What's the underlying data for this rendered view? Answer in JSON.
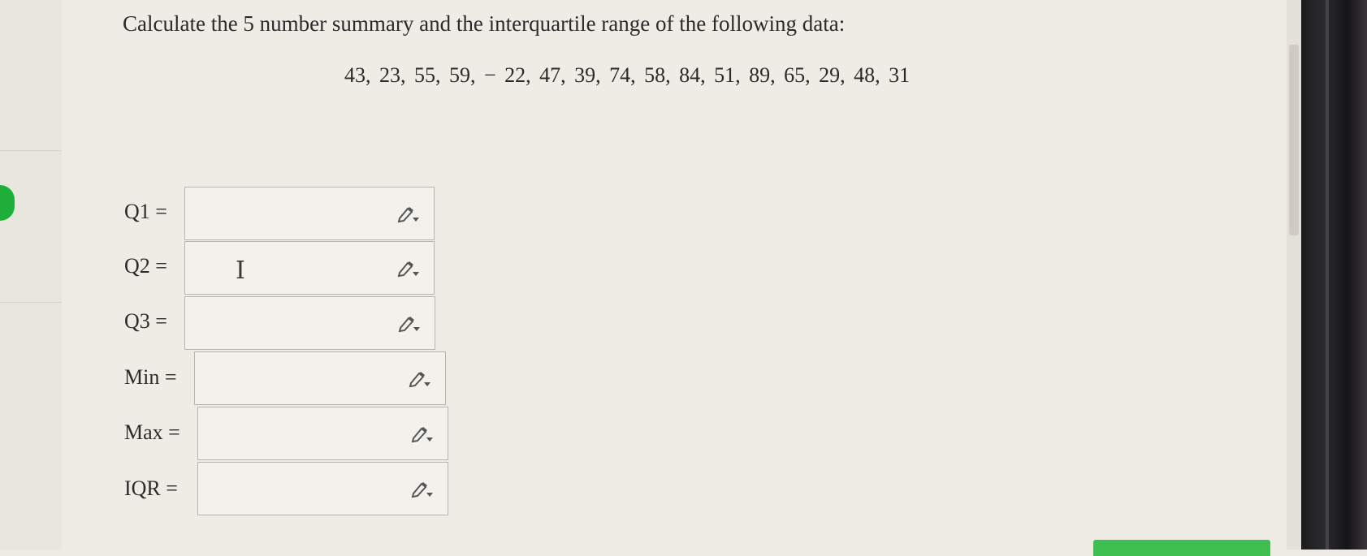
{
  "question": {
    "prompt": "Calculate the 5 number summary and the interquartile range of the following data:",
    "data_list": "43, 23, 55, 59, − 22, 47, 39, 74, 58, 84, 51, 89, 65, 29, 48, 31"
  },
  "answers": [
    {
      "label": "Q1 =",
      "value": ""
    },
    {
      "label": "Q2 =",
      "value": ""
    },
    {
      "label": "Q3 =",
      "value": ""
    },
    {
      "label": "Min =",
      "value": ""
    },
    {
      "label": "Max =",
      "value": ""
    },
    {
      "label": "IQR =",
      "value": ""
    }
  ],
  "cursor_glyph": "I",
  "colors": {
    "accent_green": "#1fae3a",
    "button_green": "#3fbf4f",
    "page_bg": "#efece6"
  },
  "icons": {
    "edit": "pencil-icon",
    "cursor": "text-cursor-icon"
  }
}
